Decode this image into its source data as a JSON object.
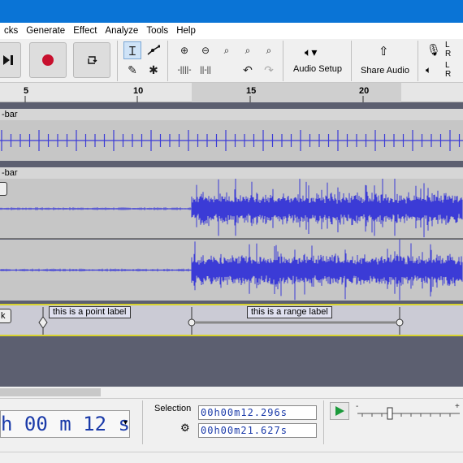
{
  "menu": {
    "items": [
      "cks",
      "Generate",
      "Effect",
      "Analyze",
      "Tools",
      "Help"
    ]
  },
  "toolbar": {
    "audio_setup_label": "Audio Setup",
    "share_audio_label": "Share Audio",
    "meter_l": "L",
    "meter_r": "R"
  },
  "ruler": {
    "ticks": [
      "5",
      "10",
      "15",
      "20"
    ]
  },
  "tracks": [
    {
      "name": "-bar"
    },
    {
      "name": "-bar"
    }
  ],
  "labels": {
    "left_fragment": "k",
    "point_label": "this is a point label",
    "range_label": "this is a range label"
  },
  "bottom": {
    "time_display": "h 00 m 12 s",
    "selection_label": "Selection",
    "selection_start": "00h00m12.296s",
    "selection_end": "00h00m21.627s"
  },
  "colors": {
    "waveform": "#3b3bd6",
    "titlebar": "#0a74d6",
    "label_border": "#d8d32f"
  }
}
